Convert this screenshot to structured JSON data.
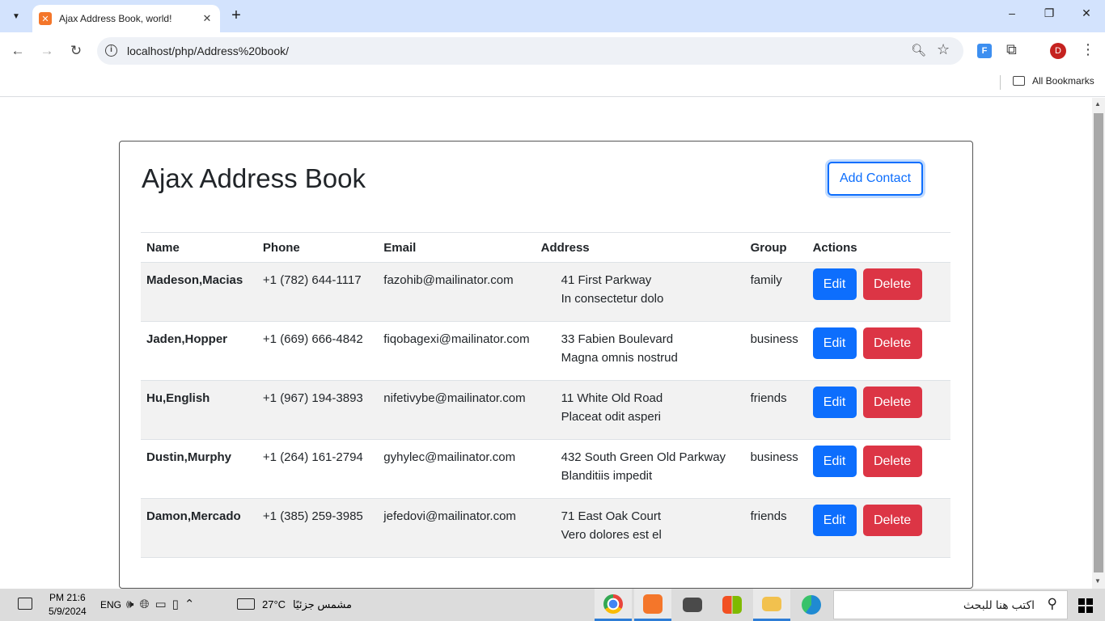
{
  "browser": {
    "tab_title": "Ajax Address Book, world!",
    "tab_close": "✕",
    "new_tab": "+",
    "url": "localhost/php/Address%20book/",
    "avatar_initial": "D",
    "bookmarks_label": "All Bookmarks",
    "extension_label": "F",
    "window_controls": [
      "–",
      "❐",
      "✕"
    ]
  },
  "page": {
    "heading": "Ajax Address Book",
    "add_button_label": "Add Contact",
    "columns": [
      "Name",
      "Phone",
      "Email",
      "Address",
      "Group",
      "Actions"
    ],
    "edit_label": "Edit",
    "delete_label": "Delete",
    "contacts": [
      {
        "name": "Madeson,Macias",
        "phone": "+1 (782) 644-1117",
        "email": "fazohib@mailinator.com",
        "address1": "41 First Parkway",
        "address2": "In consectetur dolo",
        "group": "family"
      },
      {
        "name": "Jaden,Hopper",
        "phone": "+1 (669) 666-4842",
        "email": "fiqobagexi@mailinator.com",
        "address1": "33 Fabien Boulevard",
        "address2": "Magna omnis nostrud",
        "group": "business"
      },
      {
        "name": "Hu,English",
        "phone": "+1 (967) 194-3893",
        "email": "nifetivybe@mailinator.com",
        "address1": "11 White Old Road",
        "address2": "Placeat odit asperi",
        "group": "friends"
      },
      {
        "name": "Dustin,Murphy",
        "phone": "+1 (264) 161-2794",
        "email": "gyhylec@mailinator.com",
        "address1": "432 South Green Old Parkway",
        "address2": "Blanditiis impedit",
        "group": "business"
      },
      {
        "name": "Damon,Mercado",
        "phone": "+1 (385) 259-3985",
        "email": "jefedovi@mailinator.com",
        "address1": "71 East Oak Court",
        "address2": "Vero dolores est el",
        "group": "friends"
      }
    ]
  },
  "taskbar": {
    "time": "PM 21:6",
    "date": "5/9/2024",
    "language": "ENG",
    "temperature": "27°C",
    "weather_text": "مشمس جزئيًا",
    "search_placeholder": "اكتب هنا للبحث",
    "apps": [
      "chrome-icon",
      "xampp-icon",
      "mail-icon",
      "store-icon",
      "file-explorer-icon",
      "edge-icon"
    ],
    "colors": {
      "chrome": "#e8453c",
      "xampp": "#f4762a",
      "mail": "#4a4a4a",
      "store": "#3a3a3a",
      "explorer": "#f2c14e",
      "edge": "#1f8ad2"
    }
  }
}
